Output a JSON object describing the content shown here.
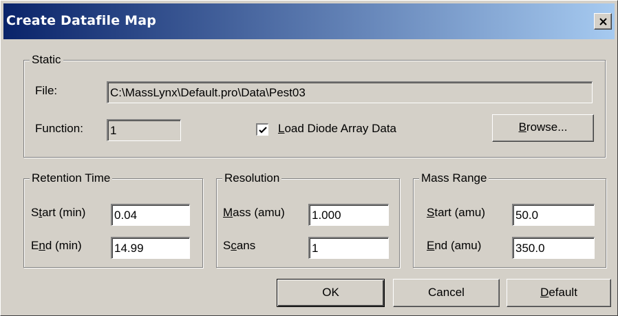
{
  "window": {
    "title": "Create Datafile Map"
  },
  "static": {
    "legend": "Static",
    "file_label": "File:",
    "file_value": "C:\\MassLynx\\Default.pro\\Data\\Pest03",
    "function_label": "Function:",
    "function_value": "1",
    "load_diode": {
      "label_pre": "",
      "label_key": "L",
      "label_post": "oad Diode Array Data",
      "checked": true
    },
    "browse": {
      "key": "B",
      "rest": "rowse..."
    }
  },
  "retention_time": {
    "legend": "Retention Time",
    "start": {
      "pre": "S",
      "key": "t",
      "post": "art (min)",
      "value": "0.04"
    },
    "end": {
      "pre": "E",
      "key": "n",
      "post": "d (min)",
      "value": "14.99"
    }
  },
  "resolution": {
    "legend": "Resolution",
    "mass": {
      "pre": "",
      "key": "M",
      "post": "ass (amu)",
      "value": "1.000"
    },
    "scans": {
      "pre": "S",
      "key": "c",
      "post": "ans",
      "value": "1"
    }
  },
  "mass_range": {
    "legend": "Mass Range",
    "start": {
      "pre": "",
      "key": "S",
      "post": "tart (amu)",
      "value": "50.0"
    },
    "end": {
      "pre": "",
      "key": "E",
      "post": "nd (amu)",
      "value": "350.0"
    }
  },
  "buttons": {
    "ok": "OK",
    "cancel": "Cancel",
    "default": {
      "key": "D",
      "rest": "efault"
    }
  },
  "icons": {
    "close": "close-icon",
    "check": "checkmark-icon"
  }
}
